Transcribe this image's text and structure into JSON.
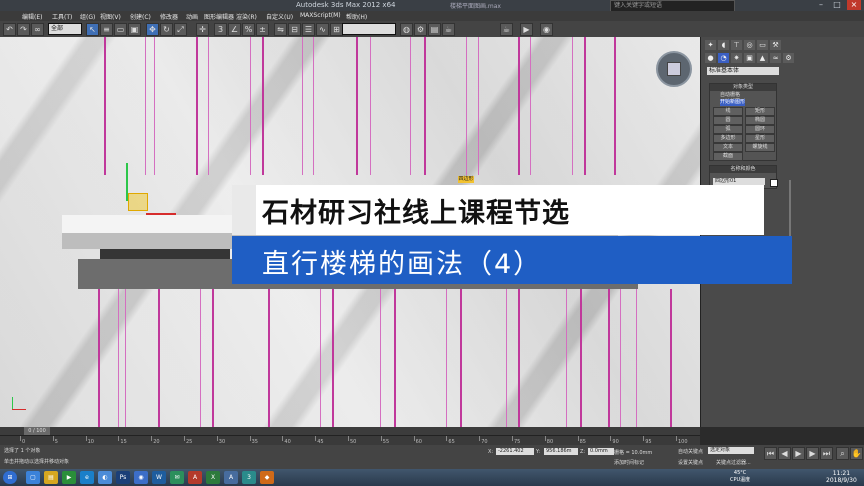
{
  "title_bar": {
    "title": "Autodesk 3ds Max  2012 x64",
    "subtitle": "楼梯平面图画.max",
    "help_search": "键入关键字或短语"
  },
  "menubar": {
    "items": [
      "编辑(E)",
      "工具(T)",
      "组(G)",
      "视图(V)",
      "创建(C)",
      "修改器",
      "动画",
      "图形编辑器",
      "渲染(R)",
      "自定义(U)",
      "MAXScript(M)",
      "帮助(H)"
    ]
  },
  "toolbar": {
    "selection_filter": "全部",
    "named_set": ""
  },
  "viewport": {
    "tag_label": "四边形"
  },
  "banner": {
    "line1": "石材研习社线上课程节选",
    "line2": "直行楼梯的画法（4）"
  },
  "command_panel": {
    "category": "标准基本体",
    "object_type_title": "对象类型",
    "autogrid_label": "自动栅格",
    "start_new_shape": "开始新图形",
    "buttons": [
      "线",
      "矩形",
      "圆",
      "椭圆",
      "弧",
      "圆环",
      "多边形",
      "星形",
      "文本",
      "螺旋线",
      "截面"
    ],
    "name_color_title": "名称和颜色",
    "name_value": "四边形01"
  },
  "timeline": {
    "frame_label": "0 / 100",
    "ticks": [
      "0",
      "5",
      "10",
      "15",
      "20",
      "25",
      "30",
      "35",
      "40",
      "45",
      "50",
      "55",
      "60",
      "65",
      "70",
      "75",
      "80",
      "85",
      "90",
      "95",
      "100"
    ]
  },
  "status": {
    "selected": "选择了 1 个对象",
    "prompt": "单击并拖动以选择并移动对象",
    "x_label": "X:",
    "x_value": "-2261.402",
    "y_label": "Y:",
    "y_value": "956.186m",
    "z_label": "Z:",
    "z_value": "0.0mm",
    "grid": "栅格 = 10.0mm",
    "autokey": "自动关键点",
    "setkey": "设置关键点",
    "selected_dropdown": "选定对象",
    "add_time_tag": "添加时间标记",
    "keyfilter": "关键点过滤器..."
  },
  "taskbar": {
    "cpu_temp": "45°C",
    "cpu_label": "CPU温度",
    "time": "11:21",
    "date": "2018/9/30"
  },
  "colors": {
    "banner_blue": "#1f5ec4",
    "mullion_magenta": "#c0389b",
    "gizmo_x": "#d62c2c",
    "gizmo_y": "#2cc64a"
  }
}
